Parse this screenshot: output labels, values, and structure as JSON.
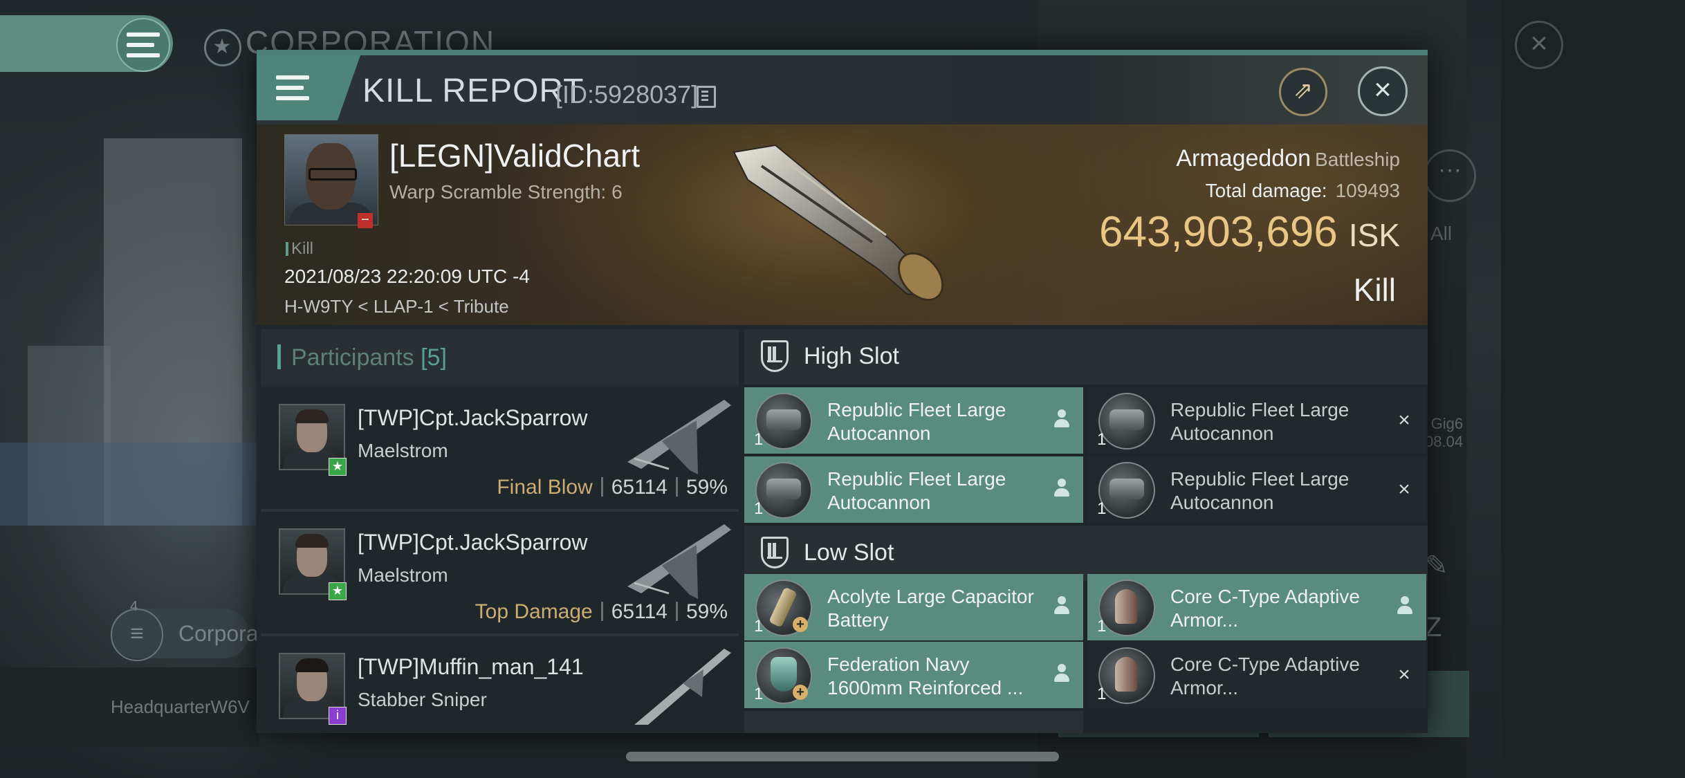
{
  "background": {
    "corp_title": "CORPORATION",
    "corp_label": "Corpora",
    "corp_badge_count": "4",
    "hq_label": "HeadquarterW6V",
    "all_label": "All",
    "gig_text_line1": "Gig6",
    "gig_text_line2": "08.04"
  },
  "dialog": {
    "title": "KILL REPORT",
    "id_label": "[ID:5928037]"
  },
  "victim": {
    "name": "[LEGN]ValidChart",
    "subtitle": "Warp Scramble Strength: 6",
    "kill_tag": "Kill",
    "datetime": "2021/08/23 22:20:09 UTC -4",
    "location": "H-W9TY < LLAP-1 < Tribute",
    "ship_name": "Armageddon",
    "ship_class": "Battleship",
    "total_damage_label": "Total damage:",
    "total_damage_value": "109493",
    "isk_value": "643,903,696",
    "isk_unit": "ISK",
    "result": "Kill"
  },
  "participants": {
    "label": "Participants",
    "count": "[5]",
    "rows": [
      {
        "name": "[TWP]Cpt.JackSparrow",
        "ship": "Maelstrom",
        "role": "Final Blow",
        "damage": "65114",
        "percent": "59%"
      },
      {
        "name": "[TWP]Cpt.JackSparrow",
        "ship": "Maelstrom",
        "role": "Top Damage",
        "damage": "65114",
        "percent": "59%"
      },
      {
        "name": "[TWP]Muffin_man_141",
        "ship": "Stabber Sniper",
        "role": "",
        "damage": "",
        "percent": ""
      }
    ]
  },
  "high_slot": {
    "title": "High Slot",
    "modules": [
      {
        "name": "Republic Fleet Large Autocannon",
        "qty": "1",
        "status": "dropped"
      },
      {
        "name": "Republic Fleet Large Autocannon",
        "qty": "1",
        "status": "destroyed"
      },
      {
        "name": "Republic Fleet Large Autocannon",
        "qty": "1",
        "status": "dropped"
      },
      {
        "name": "Republic Fleet Large Autocannon",
        "qty": "1",
        "status": "destroyed"
      }
    ]
  },
  "low_slot": {
    "title": "Low Slot",
    "modules": [
      {
        "name": "Acolyte Large Capacitor Battery",
        "qty": "1",
        "status": "dropped"
      },
      {
        "name": "Core C-Type Adaptive Armor...",
        "qty": "1",
        "status": "dropped"
      },
      {
        "name": "Federation Navy 1600mm Reinforced ...",
        "qty": "1",
        "status": "dropped"
      },
      {
        "name": "Core C-Type Adaptive Armor...",
        "qty": "1",
        "status": "destroyed"
      }
    ]
  },
  "colors": {
    "accent": "#5a8b7f",
    "isk": "#e8c684",
    "role": "#c9ad74"
  }
}
